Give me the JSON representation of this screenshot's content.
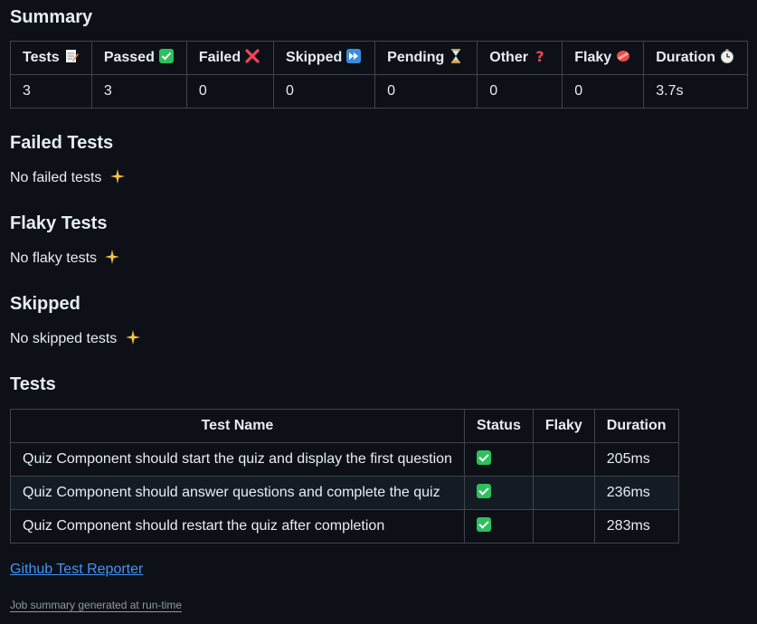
{
  "summary": {
    "heading": "Summary",
    "headers": [
      "Tests",
      "Passed",
      "Failed",
      "Skipped",
      "Pending",
      "Other",
      "Flaky",
      "Duration"
    ],
    "header_icons": [
      "memo-icon",
      "check-icon",
      "cross-icon",
      "fast-forward-icon",
      "hourglass-icon",
      "question-icon",
      "flaky-icon",
      "stopwatch-icon"
    ],
    "values": [
      "3",
      "3",
      "0",
      "0",
      "0",
      "0",
      "0",
      "3.7s"
    ]
  },
  "failed": {
    "heading": "Failed Tests",
    "text": "No failed tests"
  },
  "flaky": {
    "heading": "Flaky Tests",
    "text": "No flaky tests"
  },
  "skipped": {
    "heading": "Skipped",
    "text": "No skipped tests"
  },
  "tests": {
    "heading": "Tests",
    "headers": [
      "Test Name",
      "Status",
      "Flaky",
      "Duration"
    ],
    "rows": [
      {
        "name": "Quiz Component should start the quiz and display the first question",
        "status": "passed",
        "flaky": "",
        "duration": "205ms"
      },
      {
        "name": "Quiz Component should answer questions and complete the quiz",
        "status": "passed",
        "flaky": "",
        "duration": "236ms"
      },
      {
        "name": "Quiz Component should restart the quiz after completion",
        "status": "passed",
        "flaky": "",
        "duration": "283ms"
      }
    ]
  },
  "link": "Github Test Reporter",
  "footer": "Job summary generated at run-time",
  "colors": {
    "background": "#0d1117",
    "link": "#4493f8",
    "border": "#3d444d",
    "success": "#2fbf5e"
  }
}
